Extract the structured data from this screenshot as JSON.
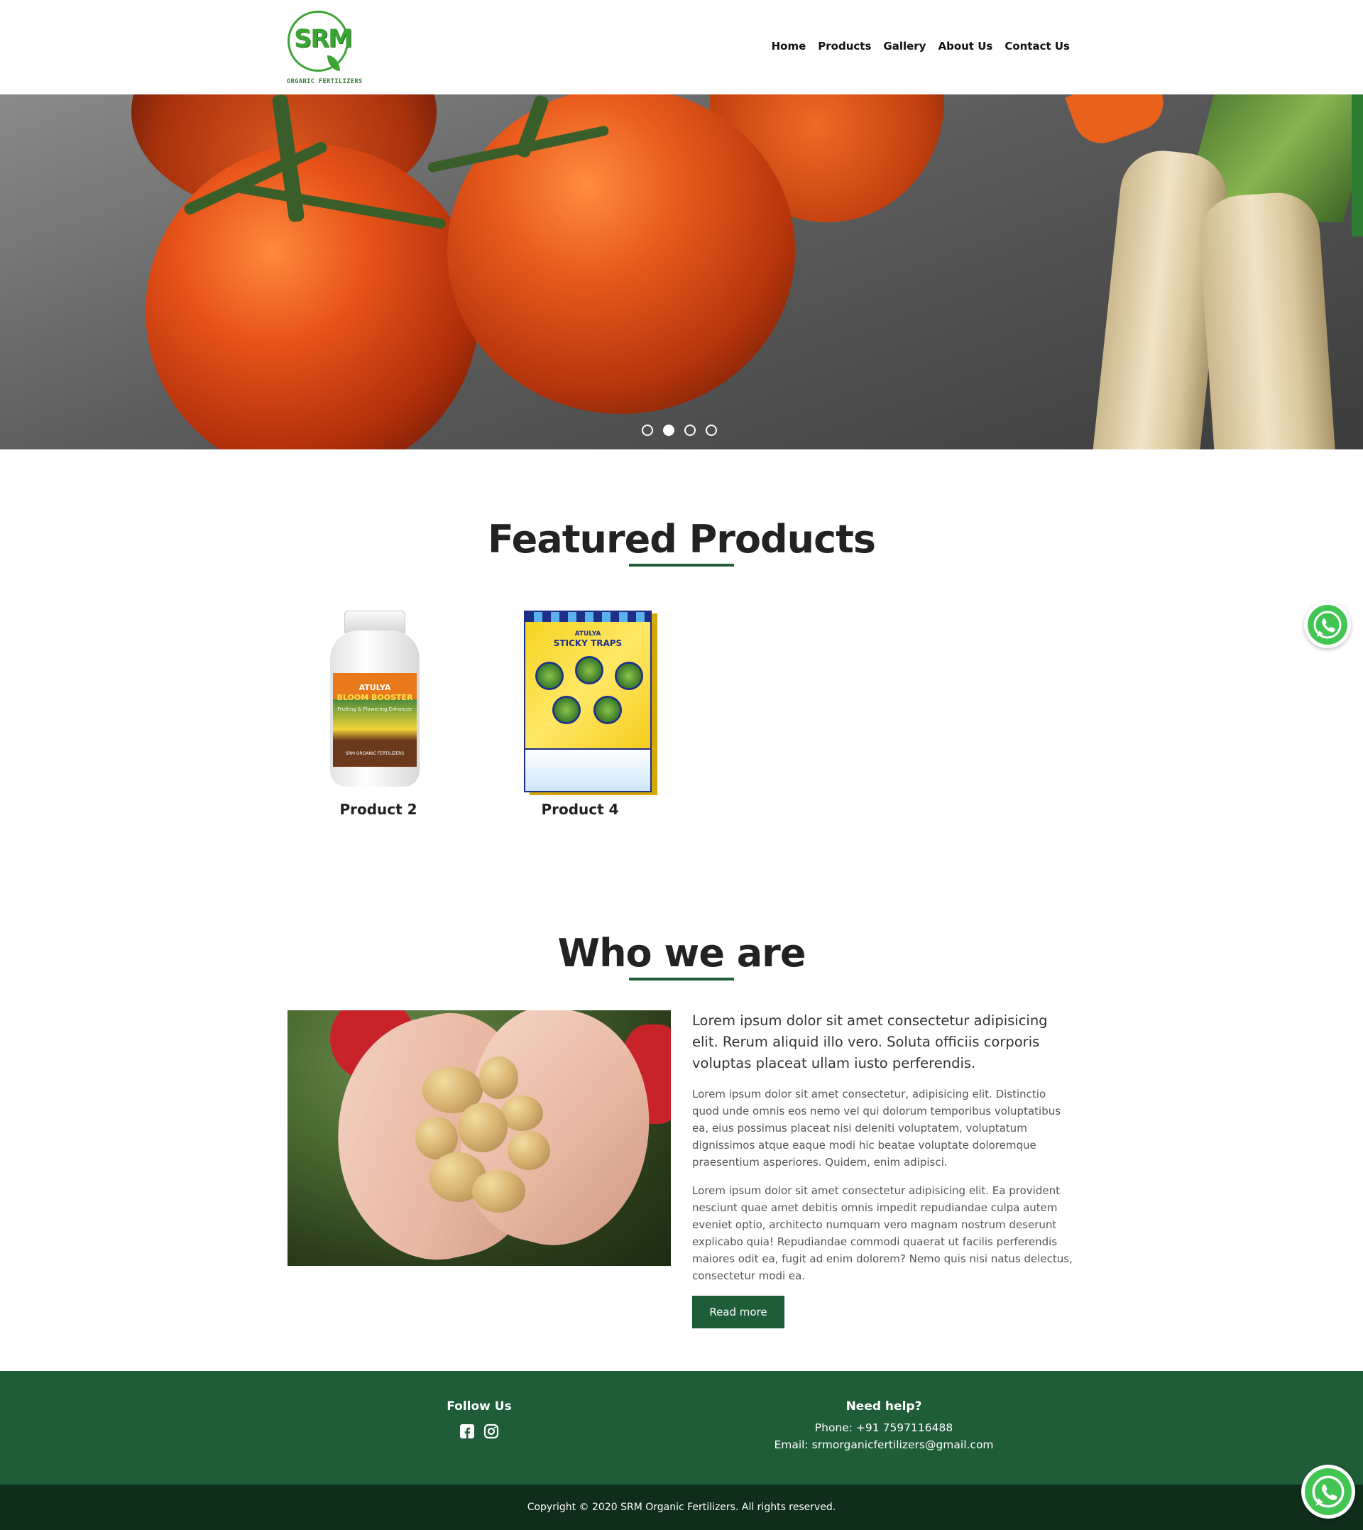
{
  "brand": {
    "logo_text": "SRM",
    "logo_tagline": "ORGANIC FERTILIZERS",
    "colors": {
      "primary": "#1f5c38",
      "logo_green": "#3aa535",
      "dark_footer": "#0f2d19"
    }
  },
  "nav": {
    "items": [
      {
        "label": "Home"
      },
      {
        "label": "Products"
      },
      {
        "label": "Gallery"
      },
      {
        "label": "About Us"
      },
      {
        "label": "Contact Us"
      }
    ]
  },
  "hero": {
    "slide_count": 4,
    "active_slide": 2
  },
  "featured": {
    "title": "Featured Products",
    "products": [
      {
        "name": "Product 2",
        "package_brand": "ATULYA",
        "package_title": "BLOOM BOOSTER",
        "package_sub": "Fruiting & Flowering Enhancer",
        "package_maker": "SRM ORGANIC FERTILIZERS"
      },
      {
        "name": "Product 4",
        "package_brand": "ATULYA",
        "package_title": "STICKY TRAPS"
      }
    ]
  },
  "who": {
    "title": "Who we are",
    "lead": "Lorem ipsum dolor sit amet consectetur adipisicing elit. Rerum aliquid illo vero. Soluta officiis corporis voluptas placeat ullam iusto perferendis.",
    "paragraphs": [
      "Lorem ipsum dolor sit amet consectetur, adipisicing elit. Distinctio quod unde omnis eos nemo vel qui dolorum temporibus voluptatibus ea, eius possimus placeat nisi deleniti voluptatem, voluptatum dignissimos atque eaque modi hic beatae voluptate doloremque praesentium asperiores. Quidem, enim adipisci.",
      "Lorem ipsum dolor sit amet consectetur adipisicing elit. Ea provident nesciunt quae amet debitis omnis impedit repudiandae culpa autem eveniet optio, architecto numquam vero magnam nostrum deserunt explicabo quia! Repudiandae commodi quaerat ut facilis perferendis maiores odit ea, fugit ad enim dolorem? Nemo quis nisi natus delectus, consectetur modi ea."
    ],
    "button_label": "Read more"
  },
  "footer": {
    "follow_title": "Follow Us",
    "social_icons": [
      "facebook-icon",
      "instagram-icon"
    ],
    "help_title": "Need help?",
    "phone": "Phone: +91 7597116488",
    "email": "Email: srmorganicfertilizers@gmail.com",
    "copyright": "Copyright © 2020 SRM Organic Fertilizers. All rights reserved."
  },
  "floating": {
    "whatsapp_icon": "whatsapp-icon"
  }
}
